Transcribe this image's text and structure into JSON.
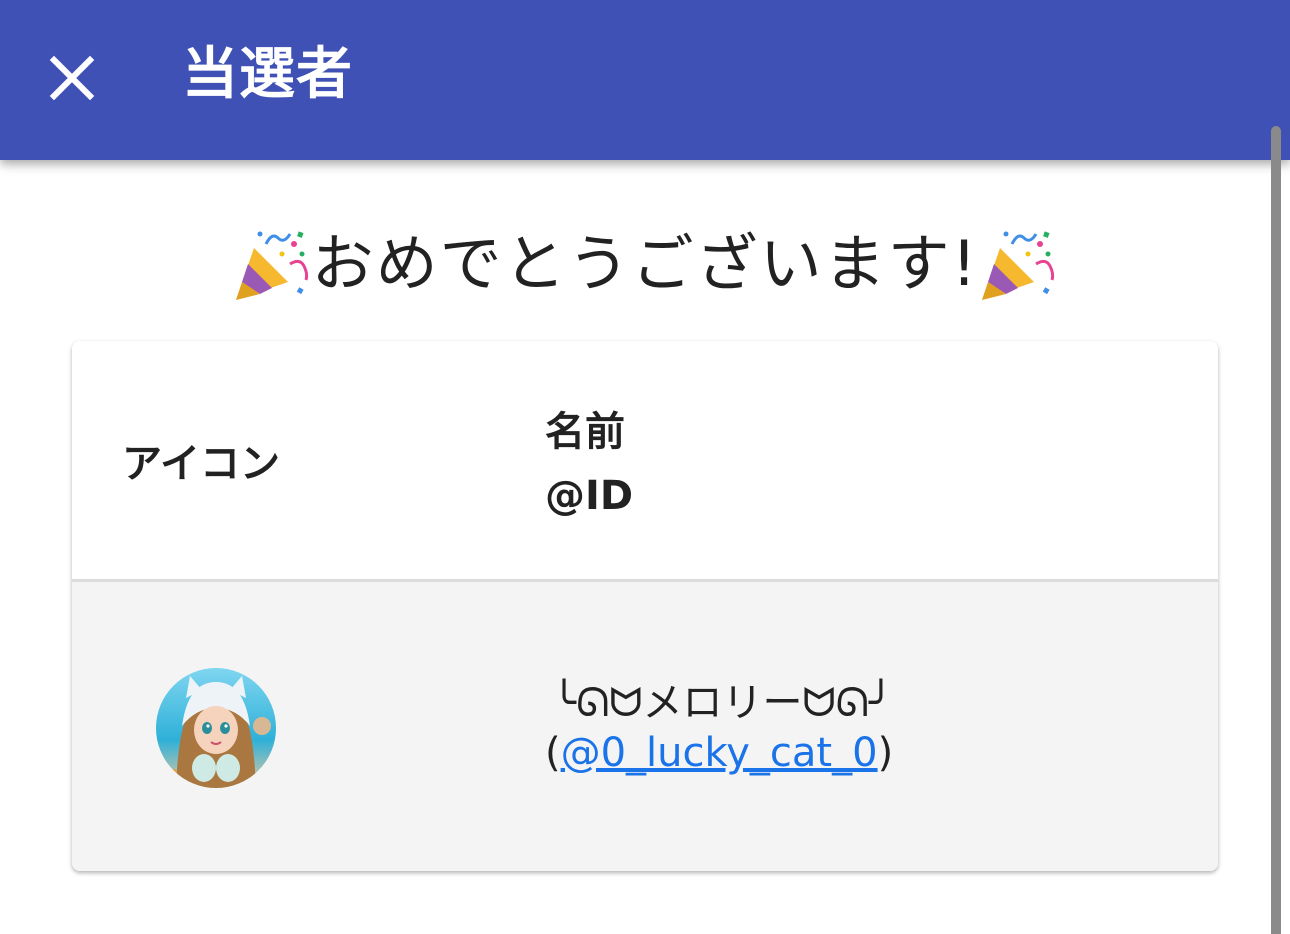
{
  "appbar": {
    "title": "当選者",
    "close_icon": "close-icon",
    "background": "#3f51b5"
  },
  "congrats": {
    "text": "おめでとうございます!",
    "left_icon": "party-popper-icon",
    "right_icon": "party-popper-icon"
  },
  "table": {
    "headers": {
      "icon": "アイコン",
      "name": "名前",
      "id": "@ID"
    },
    "rows": [
      {
        "avatar": "avatar",
        "name": "╰ᘏᗢメロリーᗢᘏ╯",
        "handle_open": "(",
        "handle": "@0_lucky_cat_0",
        "handle_close": ")"
      }
    ]
  },
  "colors": {
    "link": "#1a73e8",
    "row_bg": "#f4f4f4"
  }
}
